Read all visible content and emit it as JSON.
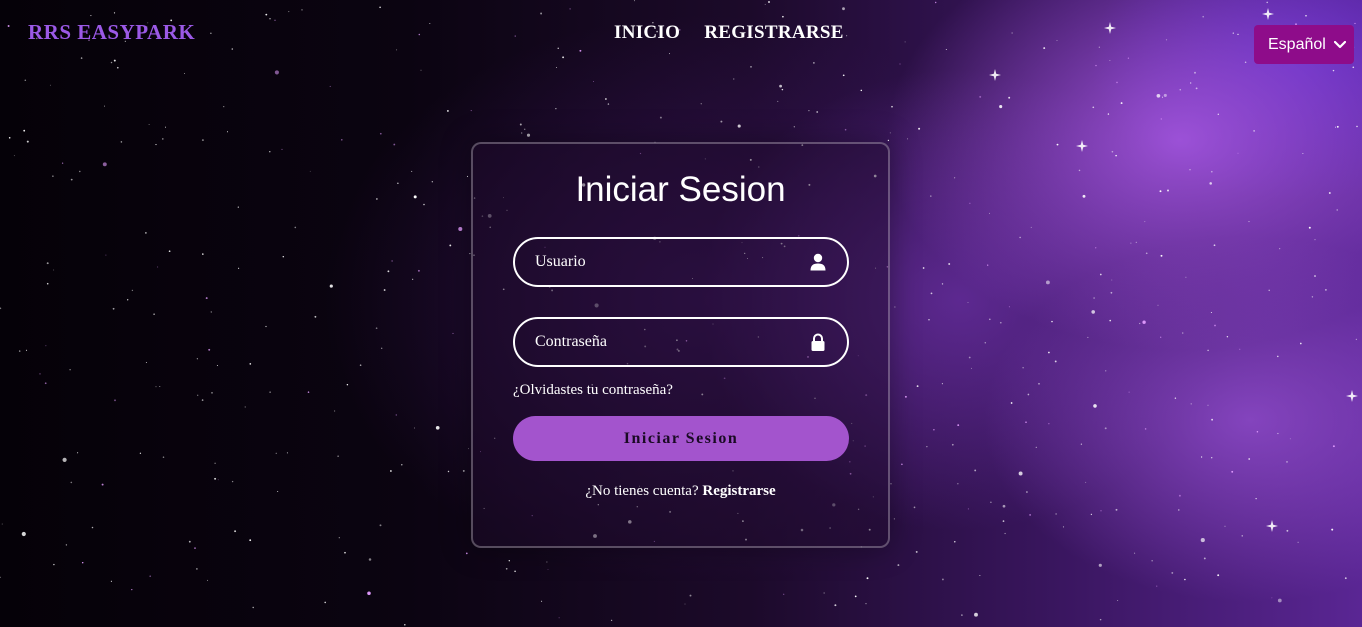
{
  "header": {
    "brand": "RRS EASYPARK",
    "nav": [
      {
        "label": "INICIO"
      },
      {
        "label": "REGISTRARSE"
      }
    ],
    "language_selected": "Español"
  },
  "login": {
    "title": "Iniciar Sesion",
    "username_placeholder": "Usuario",
    "password_placeholder": "Contraseña",
    "forgot_password": "¿Olvidastes tu contraseña?",
    "submit_label": "Iniciar Sesion",
    "no_account_text": "¿No tienes cuenta?",
    "register_link": "Registrarse"
  },
  "colors": {
    "brand": "#9b59e6",
    "language_select_bg": "#8e0c8a",
    "button_bg": "#a354cd"
  },
  "icons": {
    "username": "user-icon",
    "password": "lock-icon",
    "language": "chevron-down-icon"
  }
}
